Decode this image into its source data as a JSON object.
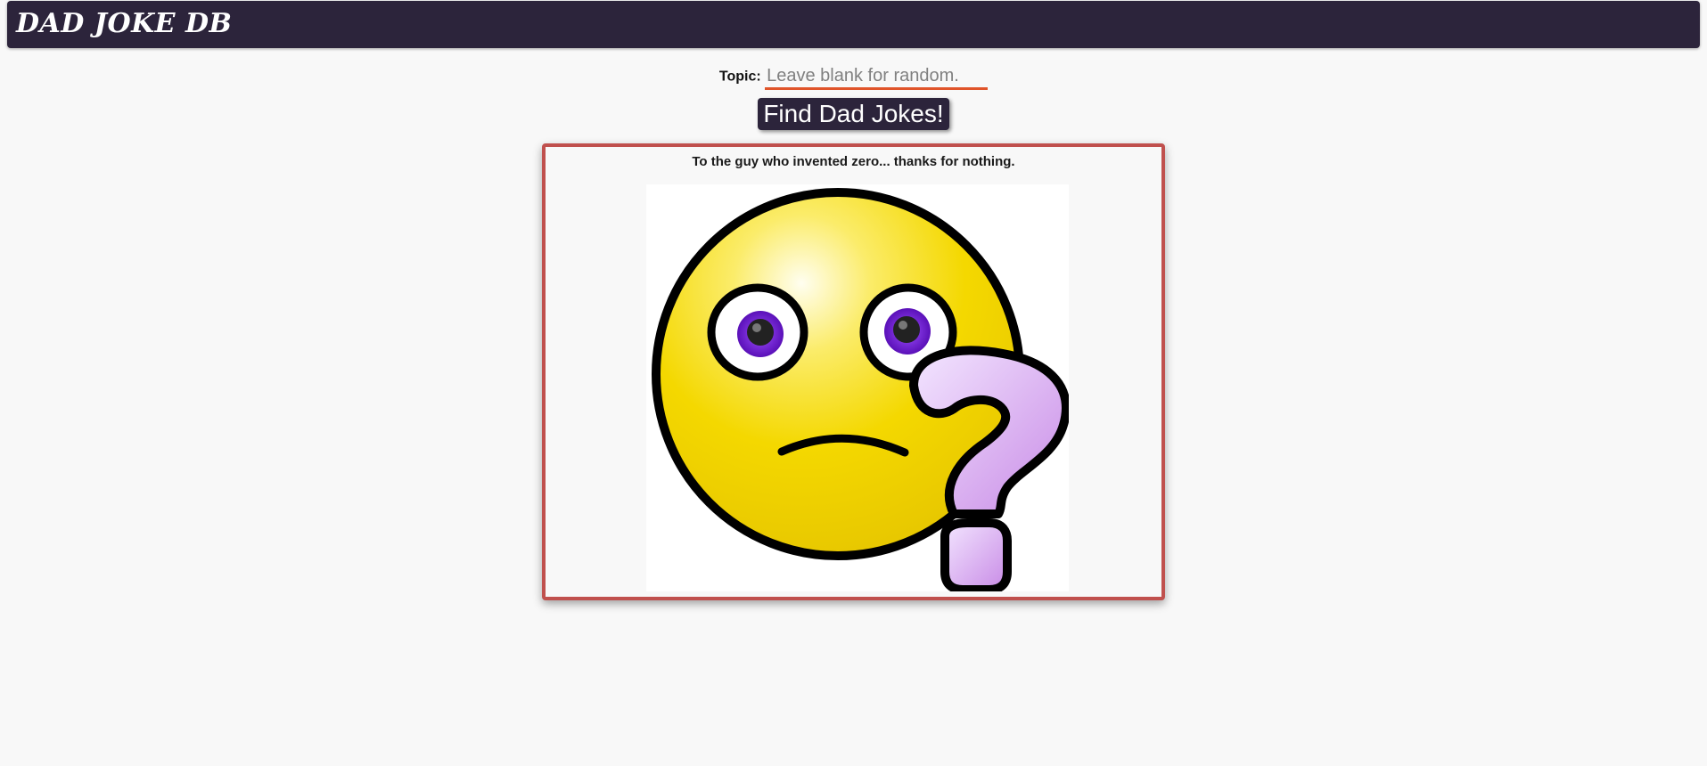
{
  "header": {
    "brand": "DAD JOKE DB"
  },
  "search": {
    "label": "Topic:",
    "value": "",
    "placeholder": "Leave blank for random.",
    "button_label": "Find Dad Jokes!"
  },
  "joke": {
    "text": "To the guy who invented zero... thanks for nothing.",
    "image_icon": "confused-face-question-mark-icon"
  },
  "colors": {
    "header_bg": "#2c243b",
    "accent_underline": "#e0542a",
    "card_border": "#c0504d",
    "page_bg": "#f8f8f8"
  }
}
